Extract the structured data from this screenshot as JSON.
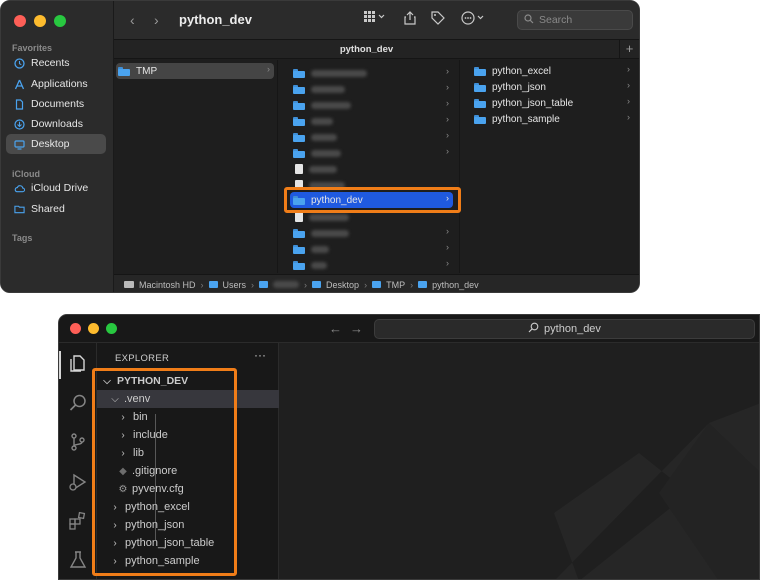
{
  "finder": {
    "title": "python_dev",
    "tab_label": "python_dev",
    "search_placeholder": "Search",
    "sidebar": {
      "favorites_label": "Favorites",
      "favorites": [
        {
          "label": "Recents",
          "icon": "clock-icon"
        },
        {
          "label": "Applications",
          "icon": "applications-icon"
        },
        {
          "label": "Documents",
          "icon": "document-icon"
        },
        {
          "label": "Downloads",
          "icon": "download-icon"
        },
        {
          "label": "Desktop",
          "icon": "desktop-icon",
          "selected": true
        }
      ],
      "icloud_label": "iCloud",
      "icloud": [
        {
          "label": "iCloud Drive",
          "icon": "cloud-icon"
        },
        {
          "label": "Shared",
          "icon": "shared-folder-icon"
        }
      ],
      "tags_label": "Tags"
    },
    "column1": [
      {
        "label": "TMP",
        "selected": true
      }
    ],
    "column2_highlight": "python_dev",
    "column3": [
      "python_excel",
      "python_json",
      "python_json_table",
      "python_sample"
    ],
    "path": {
      "hd": "Macintosh HD",
      "users": "Users",
      "desktop": "Desktop",
      "tmp": "TMP",
      "current": "python_dev"
    }
  },
  "vscode": {
    "command_center": "python_dev",
    "explorer_title": "EXPLORER",
    "more": "···",
    "root": "PYTHON_DEV",
    "venv": ".venv",
    "venv_children": [
      "bin",
      "include",
      "lib"
    ],
    "venv_files": [
      ".gitignore",
      "pyvenv.cfg"
    ],
    "folders": [
      "python_excel",
      "python_json",
      "python_json_table",
      "python_sample"
    ]
  },
  "colors": {
    "highlight_box": "#f07d18",
    "selection_blue": "#1f5ae0",
    "folder_blue": "#4aa3ef"
  }
}
